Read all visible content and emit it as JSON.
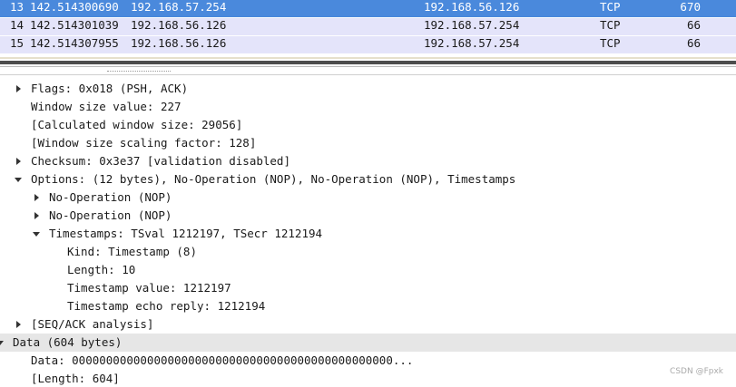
{
  "packets": [
    {
      "no": "13",
      "time": "142.514300690",
      "source": "192.168.57.254",
      "destination": "192.168.56.126",
      "protocol": "TCP",
      "length": "670",
      "selected": true
    },
    {
      "no": "14",
      "time": "142.514301039",
      "source": "192.168.56.126",
      "destination": "192.168.57.254",
      "protocol": "TCP",
      "length": "66",
      "selected": false
    },
    {
      "no": "15",
      "time": "142.514307955",
      "source": "192.168.56.126",
      "destination": "192.168.57.254",
      "protocol": "TCP",
      "length": "66",
      "selected": false
    }
  ],
  "details": [
    {
      "text": "Flags: 0x018 (PSH, ACK)",
      "arrow": "right"
    },
    {
      "text": "Window size value: 227",
      "arrow": "none"
    },
    {
      "text": "[Calculated window size: 29056]",
      "arrow": "none"
    },
    {
      "text": "[Window size scaling factor: 128]",
      "arrow": "none"
    },
    {
      "text": "Checksum: 0x3e37 [validation disabled]",
      "arrow": "right"
    },
    {
      "text": "Options: (12 bytes), No-Operation (NOP), No-Operation (NOP), Timestamps",
      "arrow": "down"
    },
    {
      "text": "No-Operation (NOP)",
      "arrow": "right"
    },
    {
      "text": "No-Operation (NOP)",
      "arrow": "right"
    },
    {
      "text": "Timestamps: TSval 1212197, TSecr 1212194",
      "arrow": "down"
    },
    {
      "text": "Kind: Timestamp (8)",
      "arrow": "none"
    },
    {
      "text": "Length: 10",
      "arrow": "none"
    },
    {
      "text": "Timestamp value: 1212197",
      "arrow": "none"
    },
    {
      "text": "Timestamp echo reply: 1212194",
      "arrow": "none"
    },
    {
      "text": "[SEQ/ACK analysis]",
      "arrow": "right"
    },
    {
      "text": "Data (604 bytes)",
      "arrow": "down"
    },
    {
      "text": "Data: 00000000000000000000000000000000000000000000000...",
      "arrow": "none"
    },
    {
      "text": "[Length: 604]",
      "arrow": "none"
    }
  ],
  "watermark": "CSDN @Fpxk",
  "colors": {
    "selected_row": "#4a89dc",
    "row_bg": "#e4e4fa",
    "highlight_row": "#e6e6e6"
  }
}
